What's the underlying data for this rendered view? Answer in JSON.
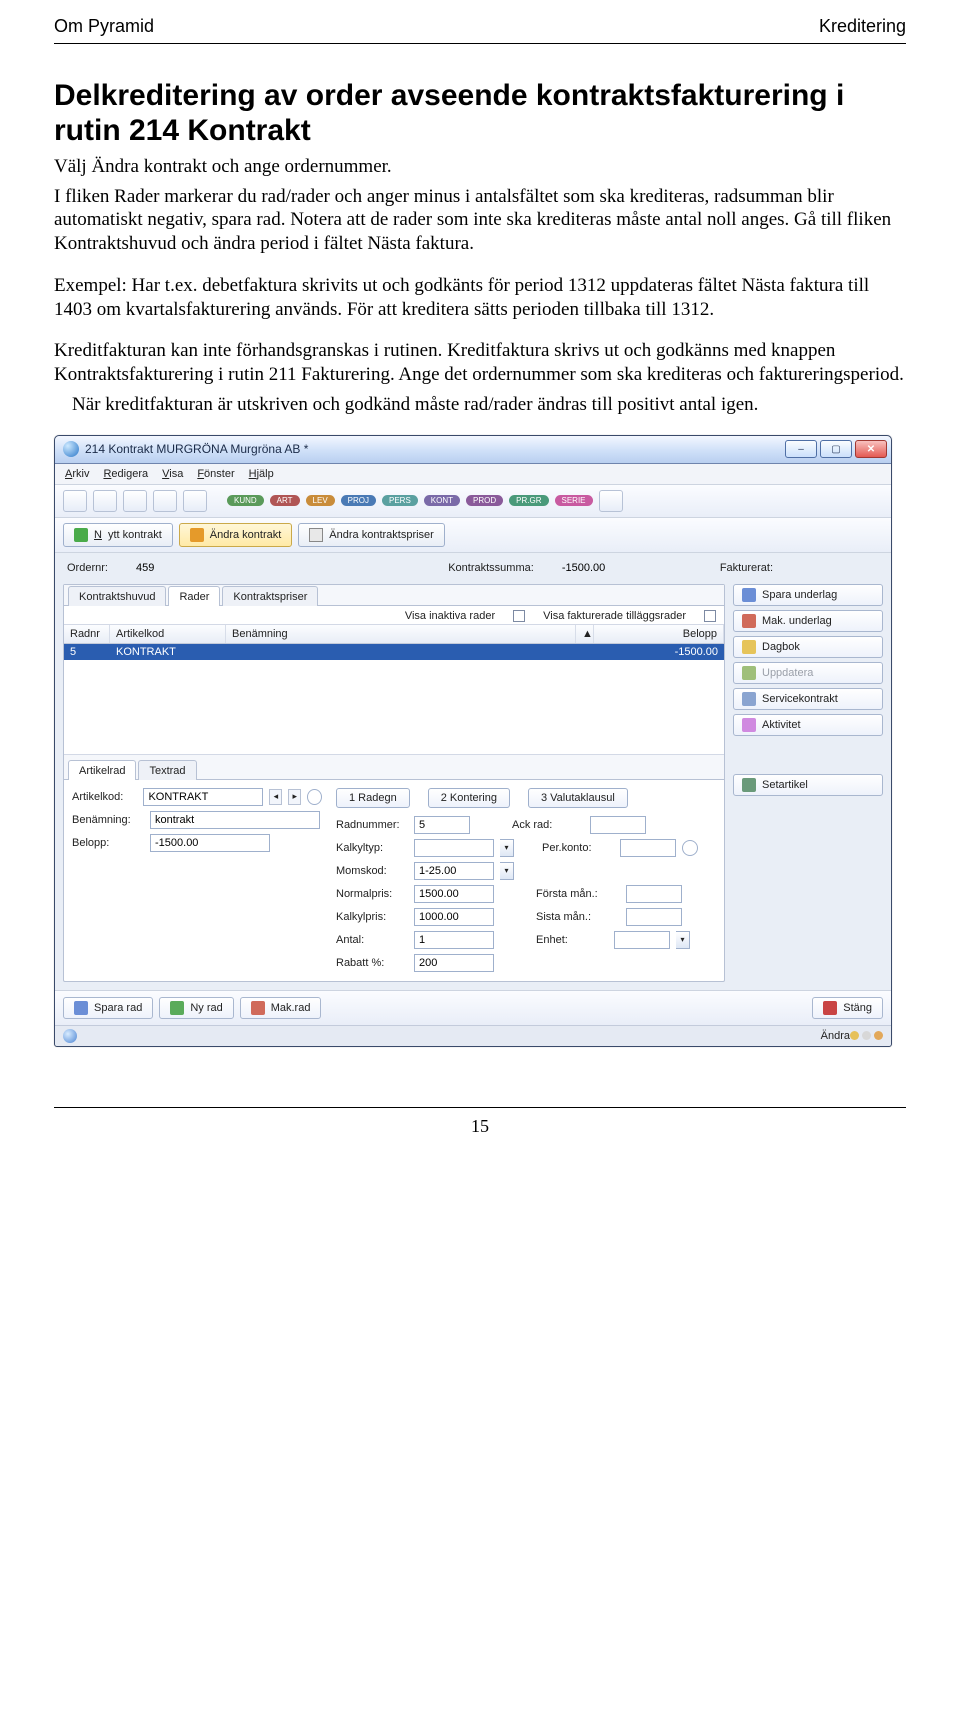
{
  "header": {
    "left": "Om Pyramid",
    "right": "Kreditering"
  },
  "title": "Delkreditering av order avseende kontraktsfakturering i rutin 214 Kontrakt",
  "paragraphs": {
    "p1": "Välj Ändra kontrakt och ange ordernummer.",
    "p2": "I fliken Rader markerar du rad/rader och anger minus i antalsfältet som ska krediteras, radsumman blir automatiskt negativ, spara rad. Notera att de rader som inte ska krediteras måste antal noll anges. Gå till fliken Kontraktshuvud och ändra period i fältet Nästa faktura.",
    "p3": "Exempel: Har t.ex. debetfaktura skrivits ut och godkänts för period 1312 uppdateras fältet Nästa faktura till 1403 om kvartalsfakturering används. För att kreditera sätts perioden tillbaka till 1312.",
    "p4": "Kreditfakturan kan inte förhandsgranskas i rutinen. Kreditfaktura skrivs ut och godkänns med knappen Kontraktsfakturering i rutin 211 Fakturering. Ange det ordernummer som ska krediteras och faktureringsperiod.",
    "p5": "När kreditfakturan är utskriven och godkänd måste rad/rader ändras till positivt antal igen."
  },
  "page_number": "15",
  "app": {
    "title": "214 Kontrakt MURGRÖNA Murgröna AB *",
    "menus": [
      "Arkiv",
      "Redigera",
      "Visa",
      "Fönster",
      "Hjälp"
    ],
    "pills": [
      "KUND",
      "ART",
      "LEV",
      "PROJ",
      "PERS",
      "KONT",
      "PROD",
      "PR.GR",
      "SERIE"
    ],
    "mode_buttons": {
      "new": "Nytt kontrakt",
      "edit": "Ändra kontrakt",
      "prices": "Ändra kontraktspriser"
    },
    "summary": {
      "ordernr_label": "Ordernr:",
      "ordernr": "459",
      "kontraktssumma_label": "Kontraktssumma:",
      "kontraktssumma": "-1500.00",
      "fakturerat_label": "Fakturerat:",
      "fakturerat": ""
    },
    "main_tabs": [
      "Kontraktshuvud",
      "Rader",
      "Kontraktspriser"
    ],
    "grid": {
      "tool_inaktiva": "Visa inaktiva rader",
      "tool_tillagg": "Visa fakturerade tilläggsrader",
      "headers": {
        "radnr": "Radnr",
        "artikelkod": "Artikelkod",
        "benamning": "Benämning",
        "belopp": "Belopp"
      },
      "row": {
        "radnr": "5",
        "artikelkod": "KONTRAKT",
        "benamning": "",
        "belopp": "-1500.00"
      }
    },
    "sub_tabs": [
      "Artikelrad",
      "Textrad"
    ],
    "detail_left": {
      "artikelkod_label": "Artikelkod:",
      "artikelkod": "KONTRAKT",
      "benamning_label": "Benämning:",
      "benamning": "kontrakt",
      "belopp_label": "Belopp:",
      "belopp": "-1500.00"
    },
    "segments": [
      "1 Radegn",
      "2 Kontering",
      "3 Valutaklausul"
    ],
    "detail_right": {
      "radnummer_label": "Radnummer:",
      "radnummer": "5",
      "ackrad_label": "Ack rad:",
      "ackrad": "",
      "kalkyltyp_label": "Kalkyltyp:",
      "kalkyltyp": "",
      "perkonto_label": "Per.konto:",
      "perkonto": "",
      "momskod_label": "Momskod:",
      "momskod": "1-25.00",
      "normalpris_label": "Normalpris:",
      "normalpris": "1500.00",
      "forstaman_label": "Första mån.:",
      "forstaman": "",
      "kalkylpris_label": "Kalkylpris:",
      "kalkylpris": "1000.00",
      "sistaman_label": "Sista mån.:",
      "sistaman": "",
      "antal_label": "Antal:",
      "antal": "1",
      "enhet_label": "Enhet:",
      "enhet": "",
      "rabatt_label": "Rabatt %:",
      "rabatt": "200"
    },
    "side_buttons": {
      "spara_underlag": "Spara underlag",
      "mak_underlag": "Mak. underlag",
      "dagbok": "Dagbok",
      "uppdatera": "Uppdatera",
      "servicekontrakt": "Servicekontrakt",
      "aktivitet": "Aktivitet",
      "setartikel": "Setartikel"
    },
    "bottom": {
      "spara_rad": "Spara rad",
      "ny_rad": "Ny rad",
      "mak_rad": "Mak.rad",
      "stang": "Stäng"
    },
    "status": {
      "mode": "Ändra"
    }
  }
}
